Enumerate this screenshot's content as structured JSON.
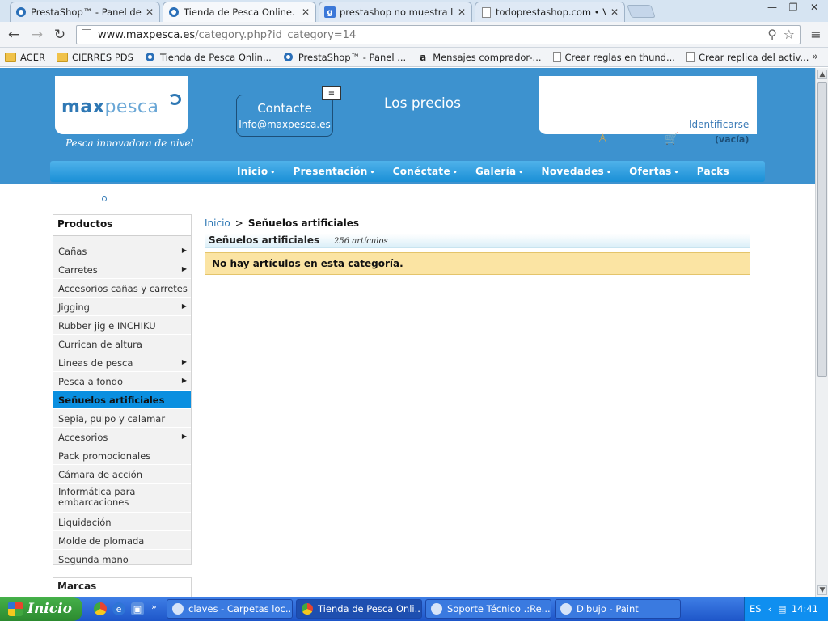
{
  "browser": {
    "tabs": [
      {
        "title": "PrestaShop™ - Panel de admi",
        "icon": "prestashop-icon",
        "active": false
      },
      {
        "title": "Tienda de Pesca Online. Artíc",
        "icon": "prestashop-icon",
        "active": true
      },
      {
        "title": "prestashop no muestra los ar",
        "icon": "google-icon",
        "active": false
      },
      {
        "title": "todoprestashop.com • Ver Te",
        "icon": "page-icon",
        "active": false
      }
    ],
    "url_host": "www.maxpesca.es",
    "url_path": "/category.php?id_category=14",
    "bookmarks": [
      {
        "label": "ACER",
        "icon": "folder-icon"
      },
      {
        "label": "CIERRES PDS",
        "icon": "folder-icon"
      },
      {
        "label": "Tienda de Pesca Onlin...",
        "icon": "prestashop-icon"
      },
      {
        "label": "PrestaShop™ - Panel ...",
        "icon": "prestashop-icon"
      },
      {
        "label": "Mensajes comprador-...",
        "icon": "amazon-icon"
      },
      {
        "label": "Crear reglas en thund...",
        "icon": "page-icon"
      },
      {
        "label": "Crear replica del activ...",
        "icon": "page-icon"
      }
    ],
    "bookmarks_more": "»"
  },
  "site": {
    "logo_a": "max",
    "logo_b": "pesca",
    "slogan": "Pesca innovadora de nivel",
    "contact_title": "Contacte",
    "contact_email": "Info@maxpesca.es",
    "precios": "Los precios",
    "login_link": "Identificarse",
    "cart_empty": "(vacía)",
    "menu": [
      "Inicio",
      "Presentación",
      "Conéctate",
      "Galería",
      "Novedades",
      "Ofertas",
      "Packs"
    ],
    "menu_dot": "•"
  },
  "sidebar": {
    "title": "Productos",
    "items": [
      {
        "label": "Cañas",
        "arrow": true
      },
      {
        "label": "Carretes",
        "arrow": true
      },
      {
        "label": "Accesorios cañas y carretes",
        "arrow": false
      },
      {
        "label": "Jigging",
        "arrow": true
      },
      {
        "label": "Rubber jig e INCHIKU",
        "arrow": false
      },
      {
        "label": "Currican de altura",
        "arrow": false
      },
      {
        "label": "Lineas de pesca",
        "arrow": true
      },
      {
        "label": "Pesca a fondo",
        "arrow": true
      },
      {
        "label": "Señuelos artificiales",
        "arrow": false,
        "active": true
      },
      {
        "label": "Sepia, pulpo y calamar",
        "arrow": false
      },
      {
        "label": "Accesorios",
        "arrow": true
      },
      {
        "label": "Pack promocionales",
        "arrow": false
      },
      {
        "label": "Cámara de acción",
        "arrow": false
      },
      {
        "label": "Informática para embarcaciones",
        "arrow": false,
        "tall": true
      },
      {
        "label": "Liquidación",
        "arrow": false
      },
      {
        "label": "Molde de plomada",
        "arrow": false
      },
      {
        "label": "Segunda mano",
        "arrow": false
      }
    ],
    "brands_title": "Marcas"
  },
  "content": {
    "breadcrumb_home": "Inicio",
    "breadcrumb_sep": ">",
    "breadcrumb_current": "Señuelos artificiales",
    "category_title": "Señuelos artificiales",
    "category_count": "256  artículos",
    "empty_message": "No hay artículos en esta categoría."
  },
  "taskbar": {
    "start_label": "Inicio",
    "tasks": [
      {
        "label": "claves - Carpetas loc...",
        "active": false
      },
      {
        "label": "Tienda de Pesca Onli...",
        "active": true
      },
      {
        "label": "Soporte Técnico .:Re...",
        "active": false
      },
      {
        "label": "Dibujo - Paint",
        "active": false
      }
    ],
    "lang": "ES",
    "clock": "14:41"
  },
  "colors": {
    "header_blue": "#3d92cf",
    "menu_blue": "#1a8fd6",
    "sidebar_active": "#0a8fe0",
    "warning_bg": "#fbe4a3"
  }
}
